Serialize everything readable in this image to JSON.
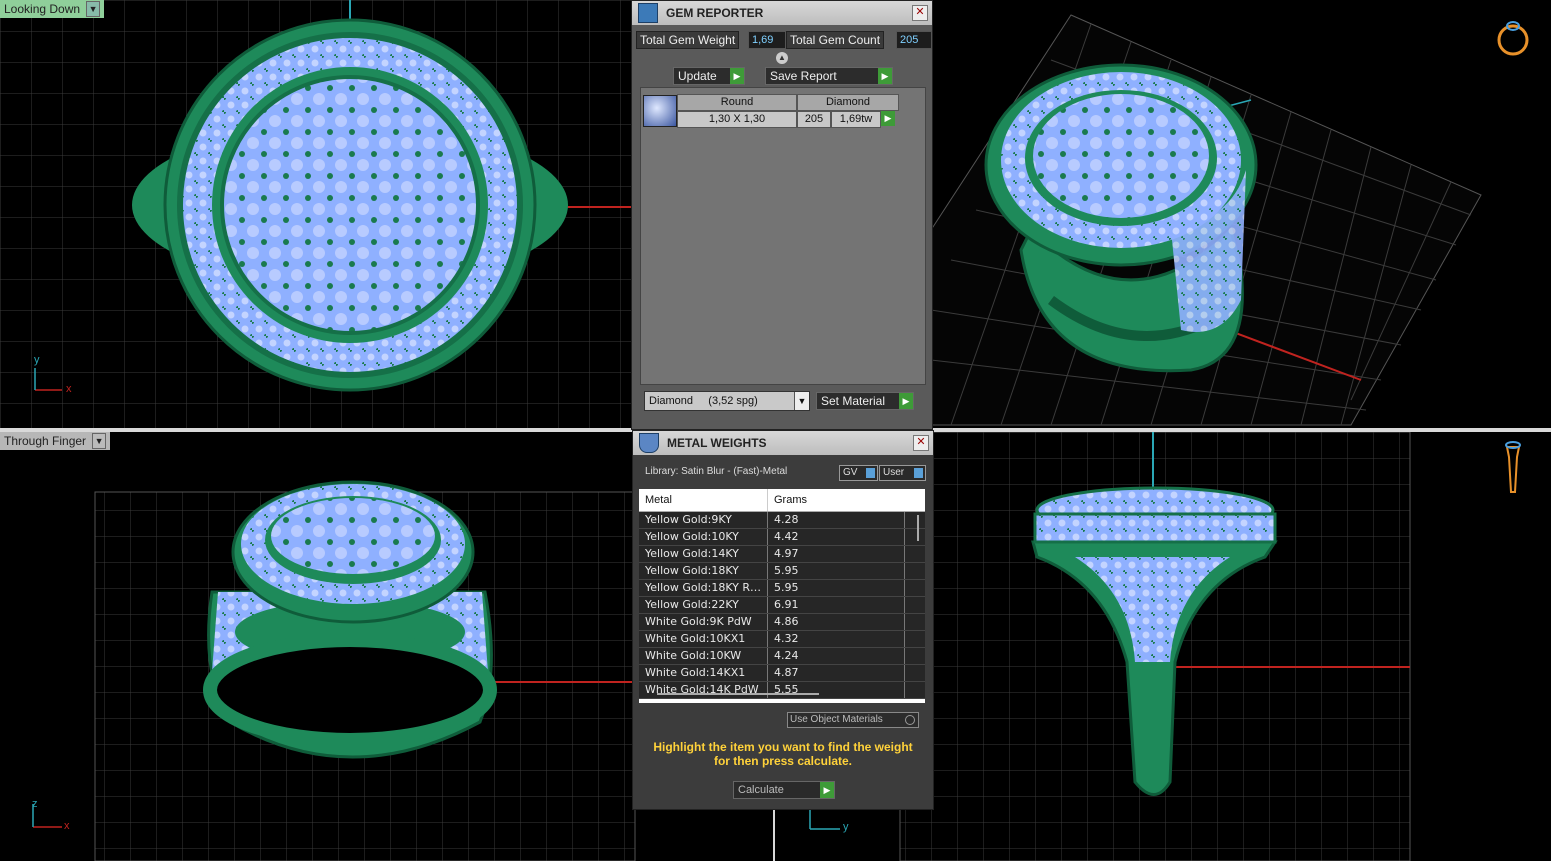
{
  "viewports": {
    "top_left": {
      "label": "Looking Down"
    },
    "bottom_left": {
      "label": "Through Finger"
    }
  },
  "axis_labels": {
    "x": "x",
    "y": "y",
    "z": "z"
  },
  "gem_reporter": {
    "title": "GEM REPORTER",
    "total_weight_label": "Total Gem Weight",
    "total_weight_value": "1,69",
    "total_count_label": "Total Gem Count",
    "total_count_value": "205",
    "update_label": "Update",
    "save_report_label": "Save Report",
    "columns": [
      "Round",
      "Diamond"
    ],
    "row": {
      "size": "1,30 X 1,30",
      "count": "205",
      "weight": "1,69tw"
    },
    "material_select": "Diamond     (3,52 spg)",
    "set_material_label": "Set Material"
  },
  "metal_weights": {
    "title": "METAL WEIGHTS",
    "library": "Library: Satin Blur - (Fast)-Metal",
    "gv_label": "GV",
    "user_label": "User",
    "columns": [
      "Metal",
      "Grams"
    ],
    "rows": [
      {
        "metal": "Yellow Gold:9KY",
        "grams": "4.28"
      },
      {
        "metal": "Yellow Gold:10KY",
        "grams": "4.42"
      },
      {
        "metal": "Yellow Gold:14KY",
        "grams": "4.97"
      },
      {
        "metal": "Yellow Gold:18KY",
        "grams": "5.95"
      },
      {
        "metal": "Yellow Gold:18KY R…",
        "grams": "5.95"
      },
      {
        "metal": "Yellow Gold:22KY",
        "grams": "6.91"
      },
      {
        "metal": "White Gold:9K PdW",
        "grams": "4.86"
      },
      {
        "metal": "White Gold:10KX1",
        "grams": "4.32"
      },
      {
        "metal": "White Gold:10KW",
        "grams": "4.24"
      },
      {
        "metal": "White Gold:14KX1",
        "grams": "4.87"
      },
      {
        "metal": "White Gold:14K PdW",
        "grams": "5.55"
      }
    ],
    "use_object_materials": "Use Object Materials",
    "hint_line1": "Highlight the item you want to find the weight",
    "hint_line2": "for then press calculate.",
    "calculate_label": "Calculate"
  },
  "colors": {
    "ring_green": "#1e8a5a",
    "gem_blue": "#8fb0ff",
    "axis_red": "#c0231f",
    "axis_cyan": "#2aa7b5"
  }
}
